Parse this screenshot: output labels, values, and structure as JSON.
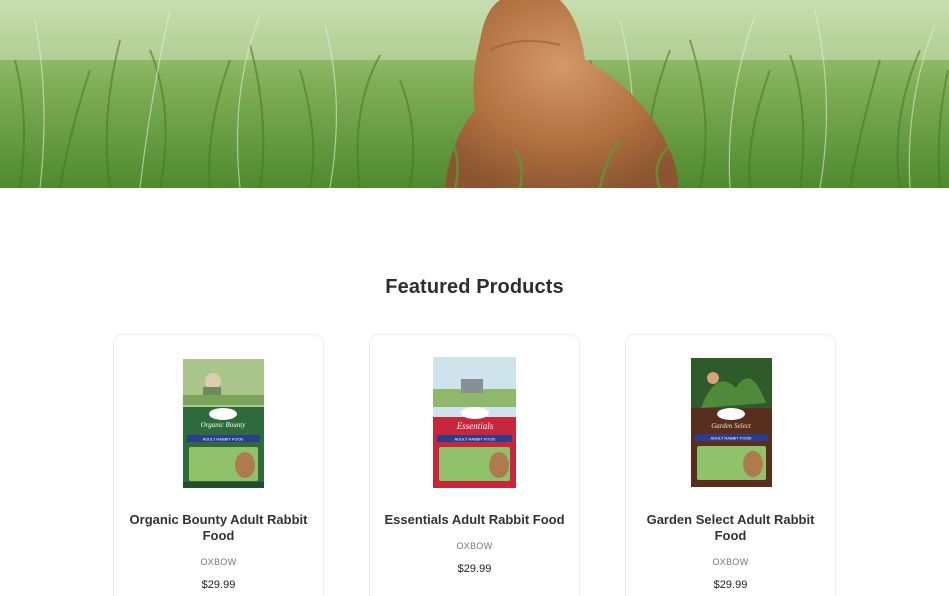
{
  "hero": {
    "image": "rabbit-in-grass-banner"
  },
  "section": {
    "title": "Featured Products"
  },
  "products": [
    {
      "name": "Organic Bounty Adult Rabbit Food",
      "brand": "OXBOW",
      "price": "$29.99",
      "accent": "#1f6b3a"
    },
    {
      "name": "Essentials Adult Rabbit Food",
      "brand": "OXBOW",
      "price": "$29.99",
      "accent": "#c8263a"
    },
    {
      "name": "Garden Select Adult Rabbit Food",
      "brand": "OXBOW",
      "price": "$29.99",
      "accent": "#5a2e1f"
    }
  ]
}
